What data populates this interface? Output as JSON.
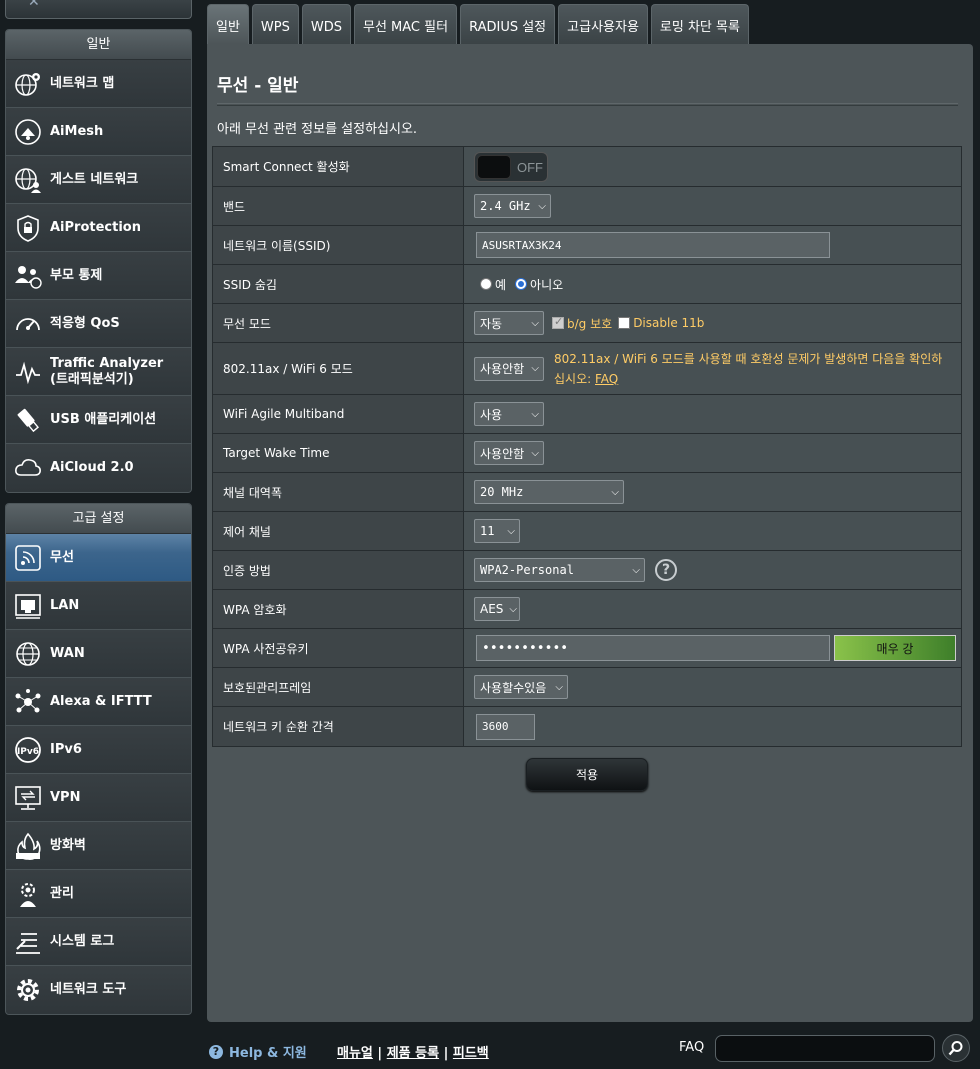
{
  "sidebar": {
    "group1_title": "일반",
    "group1": [
      {
        "label": "네트워크 맵"
      },
      {
        "label": "AiMesh"
      },
      {
        "label": "게스트 네트워크"
      },
      {
        "label": "AiProtection"
      },
      {
        "label": "부모 통제"
      },
      {
        "label": "적응형 QoS"
      },
      {
        "label": "Traffic Analyzer",
        "label2": "(트래픽분석기)"
      },
      {
        "label": "USB 애플리케이션"
      },
      {
        "label": "AiCloud 2.0"
      }
    ],
    "group2_title": "고급 설정",
    "group2": [
      {
        "label": "무선",
        "active": true
      },
      {
        "label": "LAN"
      },
      {
        "label": "WAN"
      },
      {
        "label": "Alexa & IFTTT"
      },
      {
        "label": "IPv6"
      },
      {
        "label": "VPN"
      },
      {
        "label": "방화벽"
      },
      {
        "label": "관리"
      },
      {
        "label": "시스템 로그"
      },
      {
        "label": "네트워크 도구"
      }
    ]
  },
  "tabs": [
    "일반",
    "WPS",
    "WDS",
    "무선 MAC 필터",
    "RADIUS 설정",
    "고급사용자용",
    "로밍 차단 목록"
  ],
  "page": {
    "title": "무선 - 일반",
    "description": "아래 무선 관련 정보를 설정하십시오."
  },
  "form": {
    "smart_connect": {
      "label": "Smart Connect 활성화",
      "state": "OFF"
    },
    "band": {
      "label": "밴드",
      "value": "2.4 GHz"
    },
    "ssid": {
      "label": "네트워크 이름(SSID)",
      "value": "ASUSRTAX3K24"
    },
    "hide_ssid": {
      "label": "SSID 숨김",
      "yes": "예",
      "no": "아니오"
    },
    "wireless_mode": {
      "label": "무선 모드",
      "value": "자동",
      "bg_protect": "b/g 보호",
      "disable_11b": "Disable 11b"
    },
    "ax_mode": {
      "label": "802.11ax / WiFi 6 모드",
      "value": "사용안함",
      "note1": "802.11ax / WiFi 6 모드를 사용할 때 호환성 문제가 발생하면 다음을 확인하",
      "note2": "십시오:",
      "faq": "FAQ"
    },
    "agile_multiband": {
      "label": "WiFi Agile Multiband",
      "value": "사용"
    },
    "twt": {
      "label": "Target Wake Time",
      "value": "사용안함"
    },
    "bandwidth": {
      "label": "채널 대역폭",
      "value": "20 MHz"
    },
    "control_channel": {
      "label": "제어 채널",
      "value": "11"
    },
    "auth_method": {
      "label": "인증 방법",
      "value": "WPA2-Personal"
    },
    "wpa_encryption": {
      "label": "WPA 암호화",
      "value": "AES"
    },
    "wpa_psk": {
      "label": "WPA 사전공유키",
      "value": "•••••••••••",
      "strength": "매우 강"
    },
    "pmf": {
      "label": "보호된관리프레임",
      "value": "사용할수있음"
    },
    "key_rotation": {
      "label": "네트워크 키 순환 간격",
      "value": "3600"
    }
  },
  "apply_label": "적용",
  "footer": {
    "help": "Help & 지원",
    "manual": "매뉴얼",
    "register": "제품 등록",
    "feedback": "피드백",
    "sep": "|",
    "faq": "FAQ"
  },
  "colors": {
    "accent": "#2e5a84",
    "warning_text": "#ffcc66",
    "panel": "#4d5558"
  }
}
